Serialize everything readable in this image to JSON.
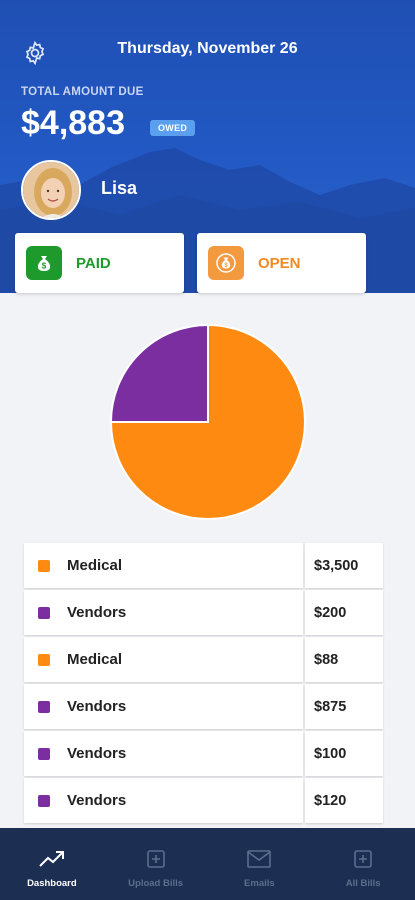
{
  "header": {
    "date": "Thursday, November 26",
    "total_label": "TOTAL AMOUNT DUE",
    "total_amount": "$4,883",
    "owed_badge": "OWED",
    "user_name": "Lisa",
    "settings_icon": "gear-icon"
  },
  "status_cards": {
    "paid_label": "PAID",
    "open_label": "OPEN"
  },
  "colors": {
    "medical": "#ff8a12",
    "vendors": "#7b2ea0",
    "paid": "#1e9a2c",
    "open": "#f39a3f",
    "header": "#2259c4"
  },
  "chart_data": {
    "type": "pie",
    "slices": [
      {
        "label": "Medical",
        "value": 0.75,
        "color": "#ff8a12"
      },
      {
        "label": "Vendors",
        "value": 0.25,
        "color": "#7b2ea0"
      }
    ]
  },
  "bills": [
    {
      "category": "Medical",
      "amount": "$3,500",
      "color": "#ff8a12"
    },
    {
      "category": "Vendors",
      "amount": "$200",
      "color": "#7b2ea0"
    },
    {
      "category": "Medical",
      "amount": "$88",
      "color": "#ff8a12"
    },
    {
      "category": "Vendors",
      "amount": "$875",
      "color": "#7b2ea0"
    },
    {
      "category": "Vendors",
      "amount": "$100",
      "color": "#7b2ea0"
    },
    {
      "category": "Vendors",
      "amount": "$120",
      "color": "#7b2ea0"
    }
  ],
  "nav": {
    "items": [
      {
        "label": "Dashboard",
        "icon": "trend-up-icon",
        "active": true
      },
      {
        "label": "Upload Bills",
        "icon": "plus-square-icon",
        "active": false
      },
      {
        "label": "Emails",
        "icon": "envelope-icon",
        "active": false
      },
      {
        "label": "All Bills",
        "icon": "plus-square-icon",
        "active": false
      }
    ]
  }
}
